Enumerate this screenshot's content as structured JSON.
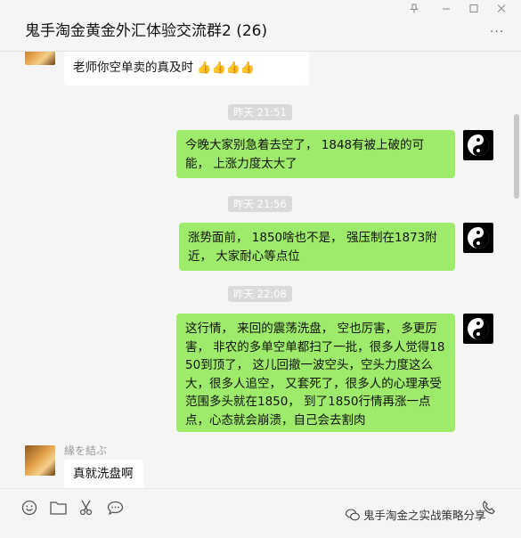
{
  "window": {
    "title": "鬼手淘金黄金外汇体验交流群2 (26)",
    "more_label": "···"
  },
  "messages": {
    "m0": {
      "text": "老师你空单卖的真及时",
      "emoji": "👍👍👍👍"
    },
    "t1": "昨天 21:51",
    "m1": {
      "text": "今晚大家别急着去空了， 1848有被上破的可能， 上涨力度太大了"
    },
    "t2": "昨天 21:56",
    "m2": {
      "text": "涨势面前， 1850啥也不是， 强压制在1873附近，   大家耐心等点位"
    },
    "t3": "昨天 22:08",
    "m3": {
      "text": "这行情， 来回的震荡洗盘，  空也厉害，  多更厉害， 非农的多单空单都扫了一批，很多人觉得1850到顶了，  这儿回撤一波空头，空头力度这么大，很多人追空， 又套死了，很多人的心理承受范围多头就在1850， 到了1850行情再涨一点点，心态就会崩溃，自己会去割肉"
    },
    "m4": {
      "sender": "緣を結ぶ",
      "text": "真就洗盘啊"
    }
  },
  "toolbar": {
    "icons": [
      "emoji-icon",
      "folder-icon",
      "scissors-icon",
      "chat-bubble-icon",
      "call-icon"
    ]
  },
  "watermark": {
    "text": "鬼手淘金之实战策略分享"
  }
}
